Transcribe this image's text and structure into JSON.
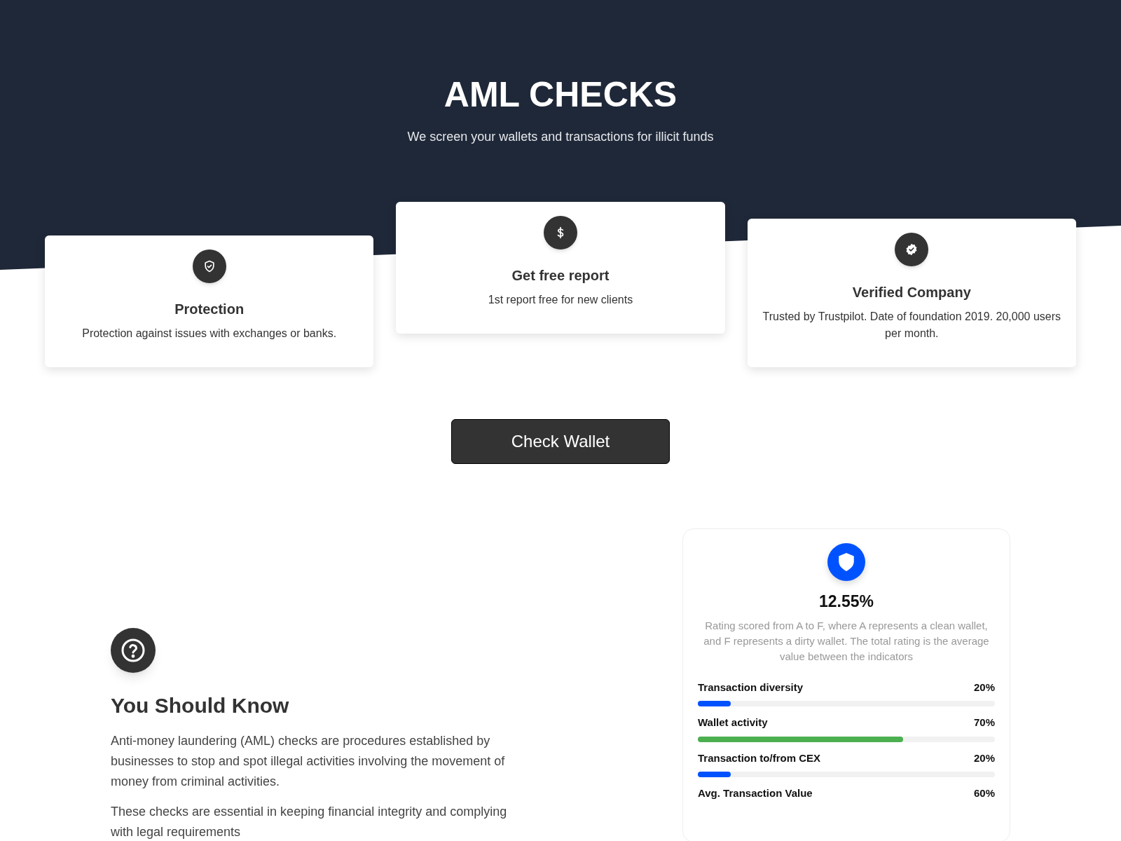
{
  "hero": {
    "title": "AML CHECKS",
    "subtitle": "We screen your wallets and transactions for illicit funds"
  },
  "features": [
    {
      "title": "Protection",
      "text": "Protection against issues with exchanges or banks."
    },
    {
      "title": "Get free report",
      "text": "1st report free for new clients"
    },
    {
      "title": "Verified Company",
      "text": "Trusted by Trustpilot. Date of foundation 2019. 20,000 users per month."
    }
  ],
  "cta": {
    "label": "Check Wallet"
  },
  "info": {
    "title": "You Should Know",
    "paragraphs": [
      "Anti-money laundering (AML) checks are procedures established by businesses to stop and spot illegal activities involving the movement of money from criminal activities.",
      "These checks are essential in keeping financial integrity and complying with legal requirements"
    ]
  },
  "rating": {
    "score": "12.55%",
    "description": "Rating scored from A to F, where A represents a clean wallet, and F represents a dirty wallet. The total rating is the average value between the indicators",
    "indicators": [
      {
        "label": "Transaction diversity",
        "value": "20%",
        "level": 0.11,
        "color": "#0052ff"
      },
      {
        "label": "Wallet activity",
        "value": "70%",
        "level": 0.69,
        "color": "#4caf50"
      },
      {
        "label": "Transaction to/from CEX",
        "value": "20%",
        "level": 0.11,
        "color": "#0052ff"
      },
      {
        "label": "Avg. Transaction Value",
        "value": "60%"
      }
    ]
  }
}
